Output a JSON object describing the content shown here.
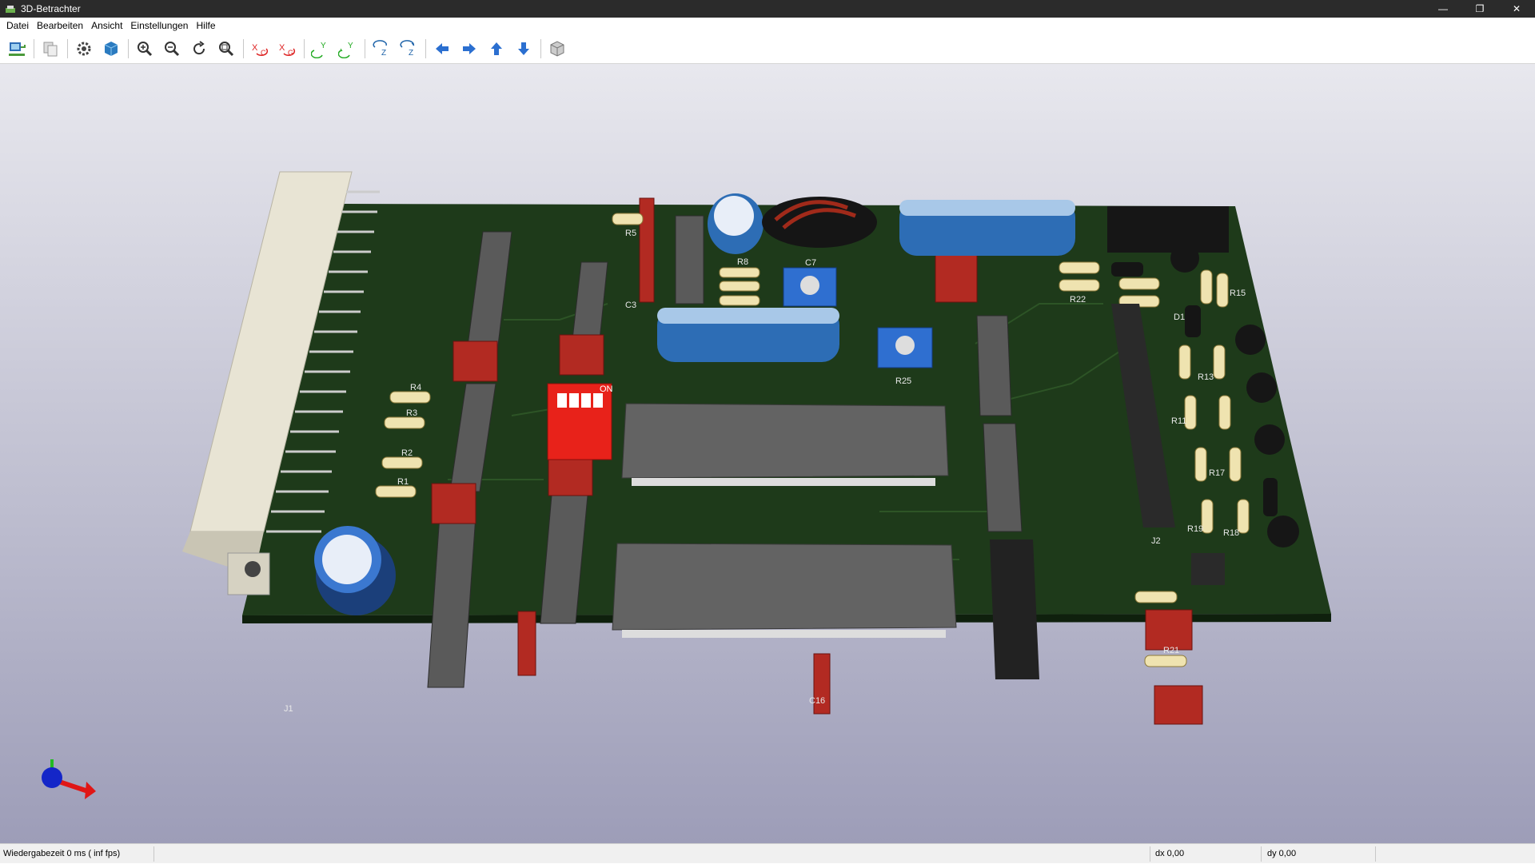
{
  "window": {
    "title": "3D-Betrachter"
  },
  "window_controls": {
    "minimize": "—",
    "restore": "❐",
    "close": "✕"
  },
  "menu": {
    "items": [
      {
        "label": "Datei"
      },
      {
        "label": "Bearbeiten"
      },
      {
        "label": "Ansicht"
      },
      {
        "label": "Einstellungen"
      },
      {
        "label": "Hilfe"
      }
    ]
  },
  "toolbar": {
    "buttons": [
      {
        "icon": "export-image-icon"
      },
      {
        "icon": "copy-clipboard-icon"
      },
      {
        "icon": "settings-gear-icon"
      },
      {
        "icon": "raytracing-cube-icon"
      },
      {
        "icon": "zoom-in-icon"
      },
      {
        "icon": "zoom-out-icon"
      },
      {
        "icon": "redraw-icon"
      },
      {
        "icon": "zoom-fit-icon"
      },
      {
        "icon": "rotate-x-cw-icon"
      },
      {
        "icon": "rotate-x-ccw-icon"
      },
      {
        "icon": "rotate-y-cw-icon"
      },
      {
        "icon": "rotate-y-ccw-icon"
      },
      {
        "icon": "rotate-z-cw-icon"
      },
      {
        "icon": "rotate-z-ccw-icon"
      },
      {
        "icon": "move-left-icon"
      },
      {
        "icon": "move-right-icon"
      },
      {
        "icon": "move-up-icon"
      },
      {
        "icon": "move-down-icon"
      },
      {
        "icon": "ortho-view-cube-icon"
      }
    ]
  },
  "viewport": {
    "colors": {
      "background_top": "#e8e8ee",
      "background_bottom": "#9d9db8",
      "board": "#1e3a1a",
      "connector": "#e8e4d4"
    },
    "labels": {
      "r4": "R4",
      "r3": "R3",
      "r2": "R2",
      "r1": "R1",
      "j1": "J1",
      "r5": "R5",
      "c3": "C3",
      "r8": "R8",
      "c7": "C7",
      "r22": "R22",
      "r25": "R25",
      "c16": "C16",
      "j2": "J2",
      "d1": "D1",
      "r11": "R11",
      "r13": "R13",
      "r15": "R15",
      "r17": "R17",
      "r18": "R18",
      "r19": "R19",
      "r21": "R21",
      "on": "ON"
    }
  },
  "status": {
    "render_time": "Wiedergabezeit 0 ms ( inf fps)",
    "dx": "dx 0,00",
    "dy": "dy 0,00"
  }
}
